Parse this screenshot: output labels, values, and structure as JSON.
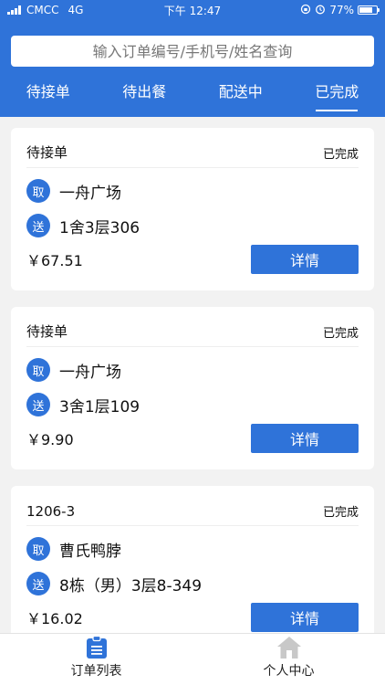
{
  "status_bar": {
    "carrier": "CMCC",
    "network": "4G",
    "time": "下午 12:47",
    "battery": "77%",
    "battery_level": 0.77
  },
  "search": {
    "placeholder": "输入订单编号/手机号/姓名查询"
  },
  "tabs": [
    {
      "label": "待接单",
      "active": false
    },
    {
      "label": "待出餐",
      "active": false
    },
    {
      "label": "配送中",
      "active": false
    },
    {
      "label": "已完成",
      "active": true
    }
  ],
  "orders": [
    {
      "title": "待接单",
      "status": "已完成",
      "pickup_badge": "取",
      "pickup": "一舟广场",
      "delivery_badge": "送",
      "delivery": "1舍3层306",
      "price": "￥67.51",
      "detail_label": "详情"
    },
    {
      "title": "待接单",
      "status": "已完成",
      "pickup_badge": "取",
      "pickup": "一舟广场",
      "delivery_badge": "送",
      "delivery": "3舍1层109",
      "price": "￥9.90",
      "detail_label": "详情"
    },
    {
      "title": "1206-3",
      "status": "已完成",
      "pickup_badge": "取",
      "pickup": "曹氏鸭脖",
      "delivery_badge": "送",
      "delivery": "8栋（男）3层8-349",
      "price": "￥16.02",
      "detail_label": "详情"
    }
  ],
  "bottom_nav": [
    {
      "label": "订单列表",
      "icon": "clipboard-list-icon",
      "active": true
    },
    {
      "label": "个人中心",
      "icon": "home-icon",
      "active": false
    }
  ],
  "colors": {
    "primary": "#2f73d9",
    "inactive_icon": "#c8c8c8"
  }
}
